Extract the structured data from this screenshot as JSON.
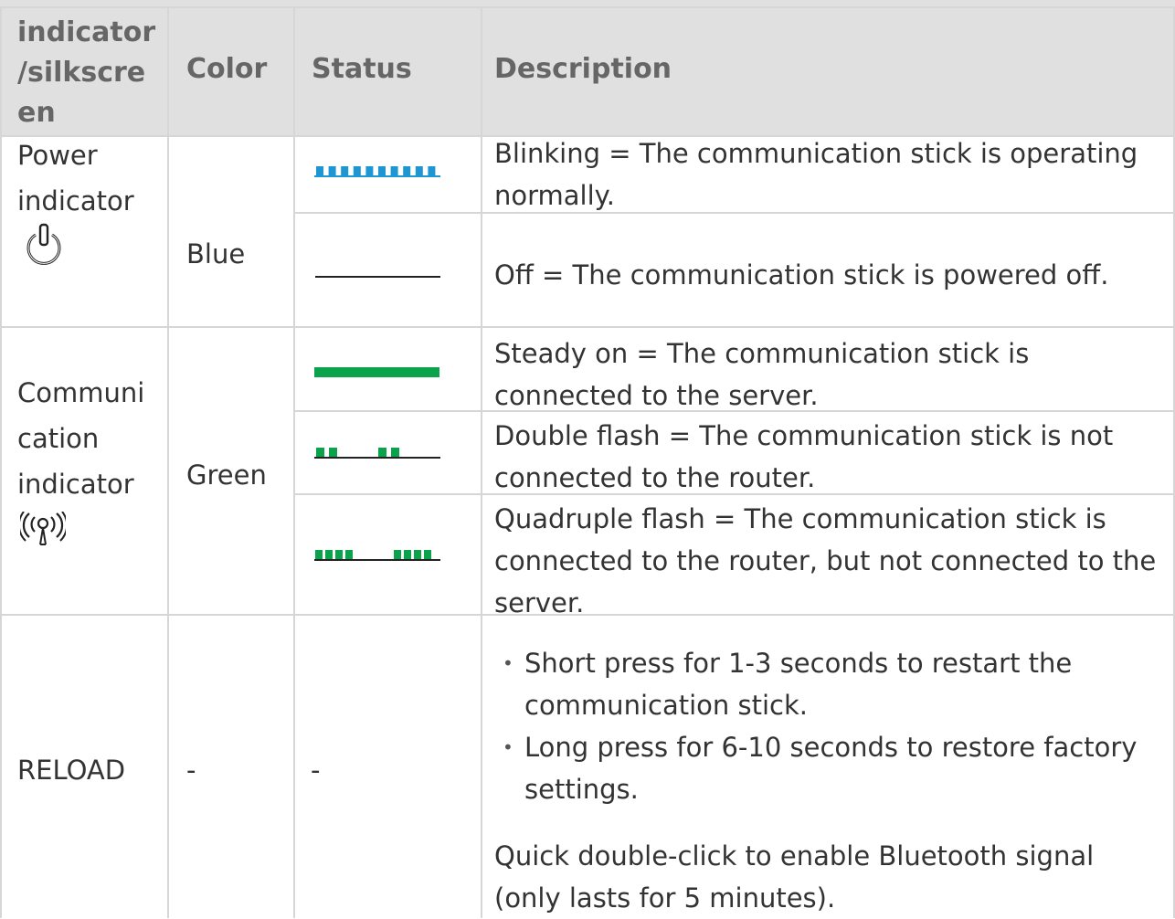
{
  "header": {
    "col1": "indicator /silkscreen",
    "col1_lines": [
      "indicator",
      "/silkscre",
      "en"
    ],
    "col2": "Color",
    "col3": "Status",
    "col4": "Description"
  },
  "rows": {
    "power": {
      "label_lines": [
        "Power",
        "indicator"
      ],
      "icon": "power-icon",
      "color": "Blue",
      "color_hex": "#1e96d4",
      "blinking": "Blinking = The communication stick is operating normally.",
      "off": "Off = The communication stick is powered off."
    },
    "communication": {
      "label_lines": [
        "Communi",
        "cation",
        "indicator"
      ],
      "icon": "wireless-signal-icon",
      "color": "Green",
      "color_hex": "#0aa24a",
      "steady": "Steady on = The communication stick is connected to the server.",
      "double": "Double flash = The communication stick is not connected to the router.",
      "quadruple": "Quadruple flash = The communication stick is connected to the router, but not connected to the server."
    },
    "reload": {
      "label": "RELOAD",
      "color": "-",
      "status": "-",
      "bullets": [
        "Short press for 1-3 seconds to restart the communication stick.",
        "Long press for 6-10 seconds to restore factory settings."
      ],
      "note": "Quick double-click to enable Bluetooth signal (only lasts for 5 minutes)."
    }
  }
}
